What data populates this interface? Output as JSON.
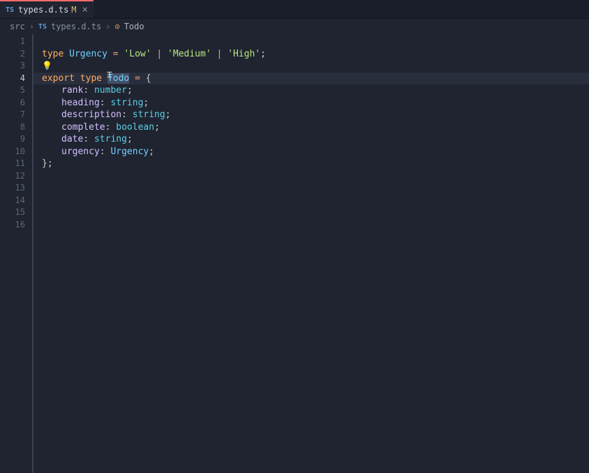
{
  "tab": {
    "icon": "TS",
    "label": "types.d.ts",
    "modified": "M",
    "close": "×"
  },
  "breadcrumb": {
    "folder": "src",
    "sep": "›",
    "file_icon": "TS",
    "file": "types.d.ts",
    "symbol_icon": "⊙",
    "symbol": "Todo"
  },
  "gutter": {
    "lines": [
      "1",
      "2",
      "3",
      "4",
      "5",
      "6",
      "7",
      "8",
      "9",
      "10",
      "11",
      "12",
      "13",
      "14",
      "15",
      "16"
    ],
    "current": 4
  },
  "code": {
    "bulb": "💡",
    "kw_type": "type",
    "kw_export": "export",
    "name_urgency": "Urgency",
    "name_todo": "Todo",
    "lit_low": "'Low'",
    "lit_medium": "'Medium'",
    "lit_high": "'High'",
    "prop_rank": "rank",
    "prop_heading": "heading",
    "prop_description": "description",
    "prop_complete": "complete",
    "prop_date": "date",
    "prop_urgency": "urgency",
    "t_number": "number",
    "t_string": "string",
    "t_boolean": "boolean",
    "eq": " = ",
    "pipe": " | ",
    "colon": ": ",
    "semi": ";",
    "brace_open": "{",
    "brace_close": "};"
  }
}
